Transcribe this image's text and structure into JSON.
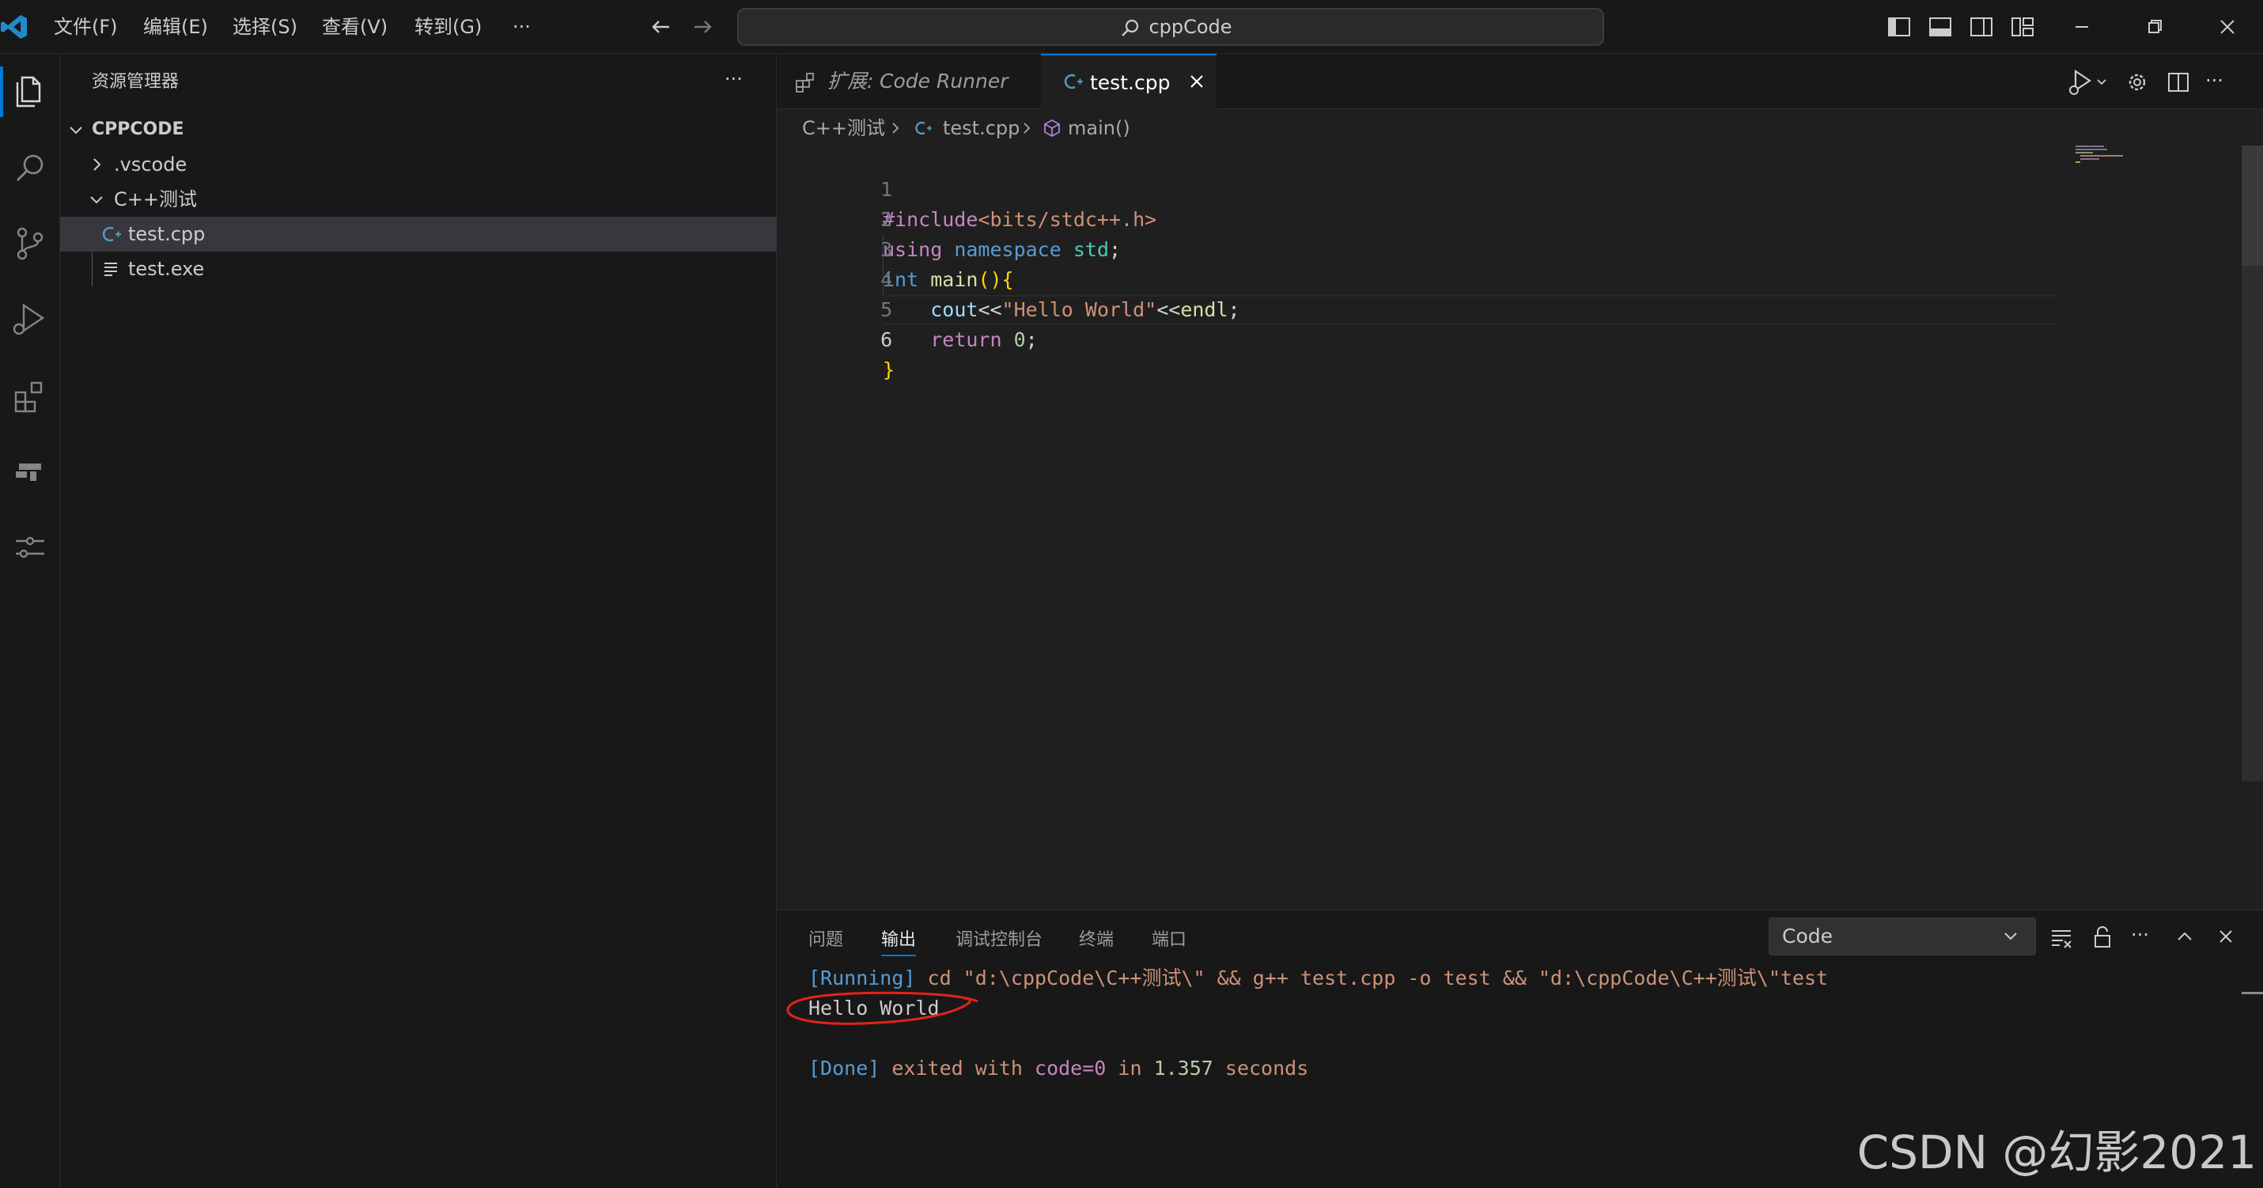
{
  "titlebar": {
    "menus": [
      "文件(F)",
      "编辑(E)",
      "选择(S)",
      "查看(V)",
      "转到(G)"
    ],
    "more": "···",
    "search_text": "cppCode"
  },
  "sidebar": {
    "title": "资源管理器",
    "more": "···",
    "root": "CPPCODE",
    "items": [
      {
        "label": ".vscode"
      },
      {
        "label": "C++测试"
      },
      {
        "label": "test.cpp"
      },
      {
        "label": "test.exe"
      }
    ]
  },
  "editor": {
    "tabs": [
      {
        "prefix": "扩展:",
        "label": "Code Runner"
      },
      {
        "label": "test.cpp"
      }
    ],
    "breadcrumb": [
      "C++测试",
      "test.cpp",
      "main()"
    ],
    "line_numbers": [
      "1",
      "2",
      "3",
      "4",
      "5",
      "6"
    ],
    "code": {
      "l1_pp": "#include",
      "l1_hdr": "<bits/stdc++.h>",
      "l2_using": "using",
      "l2_namespace": "namespace",
      "l2_std": "std",
      "l2_semi": ";",
      "l3_int": "int",
      "l3_main": "main",
      "l3_paren": "()",
      "l3_brace": "{",
      "l4_cout": "cout",
      "l4_op": "<<",
      "l4_str": "\"Hello World\"",
      "l4_op2": "<<",
      "l4_endl": "endl",
      "l4_semi": ";",
      "l5_return": "return",
      "l5_num": "0",
      "l5_semi": ";",
      "l6_brace": "}"
    }
  },
  "panel": {
    "tabs": [
      "问题",
      "输出",
      "调试控制台",
      "终端",
      "端口"
    ],
    "active_tab": "输出",
    "select_value": "Code",
    "more": "···",
    "output": {
      "running_tag": "[Running]",
      "running_cmd": "cd \"d:\\cppCode\\C++测试\\\" && g++ test.cpp -o test && \"d:\\cppCode\\C++测试\\\"test",
      "hello": "Hello World",
      "done_tag": "[Done]",
      "done_exited": "exited with",
      "done_code": "code=0",
      "done_in": "in",
      "done_secs": "1.357",
      "done_seconds": "seconds"
    }
  },
  "watermark": "CSDN @幻影2021"
}
